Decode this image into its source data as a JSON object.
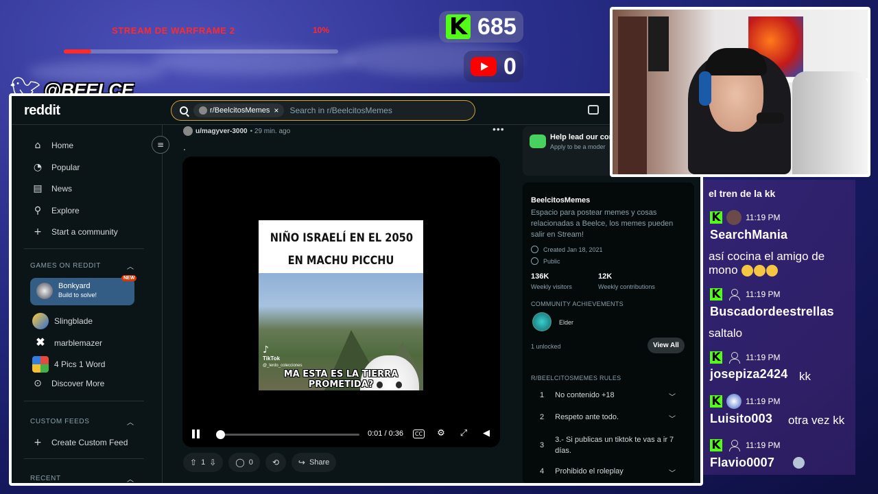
{
  "overlay": {
    "goal_title": "STREAM DE WARFRAME 2",
    "goal_percent": "10%",
    "goal_progress": 0.1,
    "kick_count": "685",
    "youtube_count": "0",
    "twitter_handle": "@BEELCE_",
    "colors": {
      "goal_red": "#ff2a2a",
      "kick_green": "#53fc18",
      "youtube_red": "#ff0000"
    }
  },
  "reddit": {
    "logo": "reddit",
    "search": {
      "chip": "r/BeelcitosMemes",
      "placeholder": "Search in r/BeelcitosMemes"
    },
    "sidebar": {
      "nav": [
        {
          "label": "Home",
          "icon": "home-icon"
        },
        {
          "label": "Popular",
          "icon": "popular-icon"
        },
        {
          "label": "News",
          "icon": "news-icon"
        },
        {
          "label": "Explore",
          "icon": "explore-icon"
        },
        {
          "label": "Start a community",
          "icon": "plus-icon"
        }
      ],
      "games_label": "GAMES ON REDDIT",
      "games": [
        {
          "title": "Bonkyard",
          "subtitle": "Build to solve!",
          "badge": "NEW"
        },
        {
          "title": "Slingblade"
        },
        {
          "title": "marblemazer"
        },
        {
          "title": "4 Pics 1 Word"
        },
        {
          "title": "Discover More"
        }
      ],
      "custom_feeds_label": "CUSTOM FEEDS",
      "create_custom_feed": "Create Custom Feed",
      "recent_label": "RECENT"
    },
    "post": {
      "author": "u/magyver-3000",
      "time": "• 29 min. ago",
      "title": ".",
      "meme": {
        "top_line1": "NIÑO ISRAELÍ EN EL 2050",
        "top_line2": "EN MACHU PICCHU",
        "bottom": "MA ESTA ES LA TIERRA PROMETIDA?",
        "watermark": "TikTok",
        "watermark_user": "@_lerdo_colecciones"
      },
      "player": {
        "time": "0:01 / 0:36",
        "cc": "CC",
        "progress": 0.03
      },
      "votes": "1",
      "comments": "0",
      "share": "Share"
    },
    "right_panel": {
      "promo_title": "Help lead our cor",
      "promo_sub": "Apply to be a moder",
      "community_name": "BeelcitosMemes",
      "description": "Espacio para postear memes y cosas relacionadas a Beelce, los memes pueden salir en Stream!",
      "created": "Created Jan 18, 2021",
      "visibility": "Public",
      "visitors_value": "136K",
      "visitors_label": "Weekly visitors",
      "contrib_value": "12K",
      "contrib_label": "Weekly contributions",
      "achievements_label": "COMMUNITY ACHIEVEMENTS",
      "achievement": "Elder",
      "unlocked": "1 unlocked",
      "view_all": "View All",
      "rules_label": "R/BEELCITOSMEMES RULES",
      "rules": [
        {
          "num": "1",
          "text": "No contenido +18"
        },
        {
          "num": "2",
          "text": "Respeto ante todo."
        },
        {
          "num": "3",
          "text": "3.- Si publicas un tiktok te vas a ir 7 días."
        },
        {
          "num": "4",
          "text": "Prohibido el roleplay"
        }
      ]
    }
  },
  "chat": {
    "cut_text": "el tren de la kk",
    "messages": [
      {
        "time": "11:19 PM",
        "user": "SearchMania",
        "text": "así cocina el amigo de mono"
      },
      {
        "time": "11:19 PM",
        "user": "Buscadordeestrellas",
        "text": "saltalo"
      },
      {
        "time": "11:19 PM",
        "user": "josepiza2424",
        "text": "kk"
      },
      {
        "time": "11:19 PM",
        "user": "Luisito003",
        "text": "otra vez kk"
      },
      {
        "time": "11:19 PM",
        "user": "Flavio0007",
        "text": ""
      }
    ]
  }
}
